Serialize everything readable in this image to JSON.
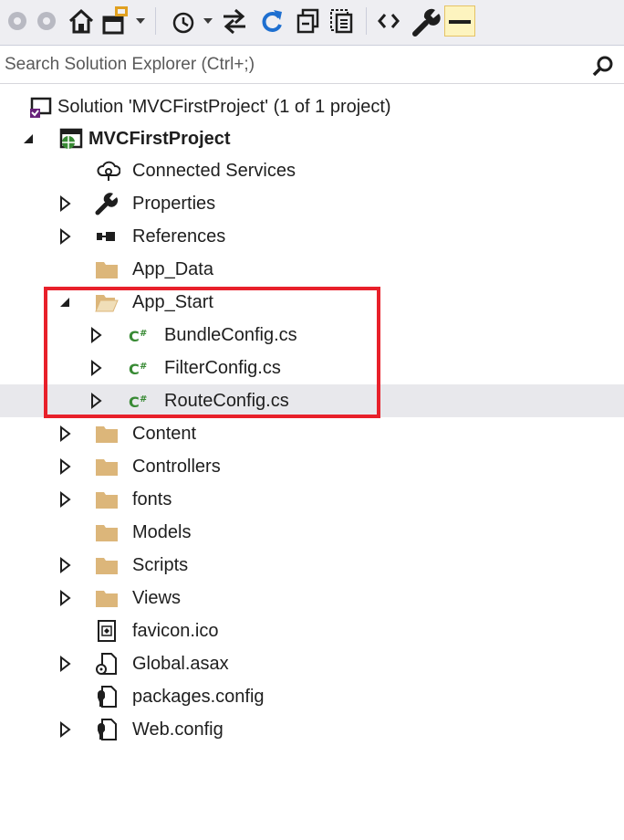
{
  "toolbar": {
    "buttons": [
      {
        "name": "back-icon"
      },
      {
        "name": "forward-icon"
      },
      {
        "name": "home-icon"
      },
      {
        "name": "switch-views-icon"
      },
      {
        "name": "pending-changes-filter-icon"
      },
      {
        "name": "sync-active-document-icon"
      },
      {
        "name": "refresh-icon"
      },
      {
        "name": "collapse-all-icon"
      },
      {
        "name": "show-all-files-icon"
      },
      {
        "name": "code-view-icon"
      },
      {
        "name": "properties-wrench-icon"
      },
      {
        "name": "preview-selected-items-icon"
      }
    ]
  },
  "search": {
    "placeholder": "Search Solution Explorer (Ctrl+;)"
  },
  "tree": {
    "solution": "Solution 'MVCFirstProject' (1 of 1 project)",
    "project": "MVCFirstProject",
    "items": [
      {
        "label": "Connected Services",
        "icon": "connected-services-icon",
        "expand": "none"
      },
      {
        "label": "Properties",
        "icon": "wrench-icon",
        "expand": "collapsed"
      },
      {
        "label": "References",
        "icon": "references-icon",
        "expand": "collapsed"
      },
      {
        "label": "App_Data",
        "icon": "folder-icon",
        "expand": "none"
      },
      {
        "label": "App_Start",
        "icon": "folder-open-icon",
        "expand": "expanded"
      },
      {
        "label": "BundleConfig.cs",
        "icon": "csharp-file-icon",
        "expand": "collapsed"
      },
      {
        "label": "FilterConfig.cs",
        "icon": "csharp-file-icon",
        "expand": "collapsed"
      },
      {
        "label": "RouteConfig.cs",
        "icon": "csharp-file-icon",
        "expand": "collapsed"
      },
      {
        "label": "Content",
        "icon": "folder-icon",
        "expand": "collapsed"
      },
      {
        "label": "Controllers",
        "icon": "folder-icon",
        "expand": "collapsed"
      },
      {
        "label": "fonts",
        "icon": "folder-icon",
        "expand": "collapsed"
      },
      {
        "label": "Models",
        "icon": "folder-icon",
        "expand": "none"
      },
      {
        "label": "Scripts",
        "icon": "folder-icon",
        "expand": "collapsed"
      },
      {
        "label": "Views",
        "icon": "folder-icon",
        "expand": "collapsed"
      },
      {
        "label": "favicon.ico",
        "icon": "icon-file-icon",
        "expand": "none"
      },
      {
        "label": "Global.asax",
        "icon": "asax-file-icon",
        "expand": "collapsed"
      },
      {
        "label": "packages.config",
        "icon": "config-file-icon",
        "expand": "none"
      },
      {
        "label": "Web.config",
        "icon": "config-file-icon",
        "expand": "collapsed"
      }
    ],
    "selected": "RouteConfig.cs"
  },
  "colors": {
    "highlight_box": "#e8202a",
    "folder": "#dcb67a",
    "csharp": "#388a34",
    "selection": "#e8e8ec",
    "toolbar_bg": "#eeeef2"
  }
}
